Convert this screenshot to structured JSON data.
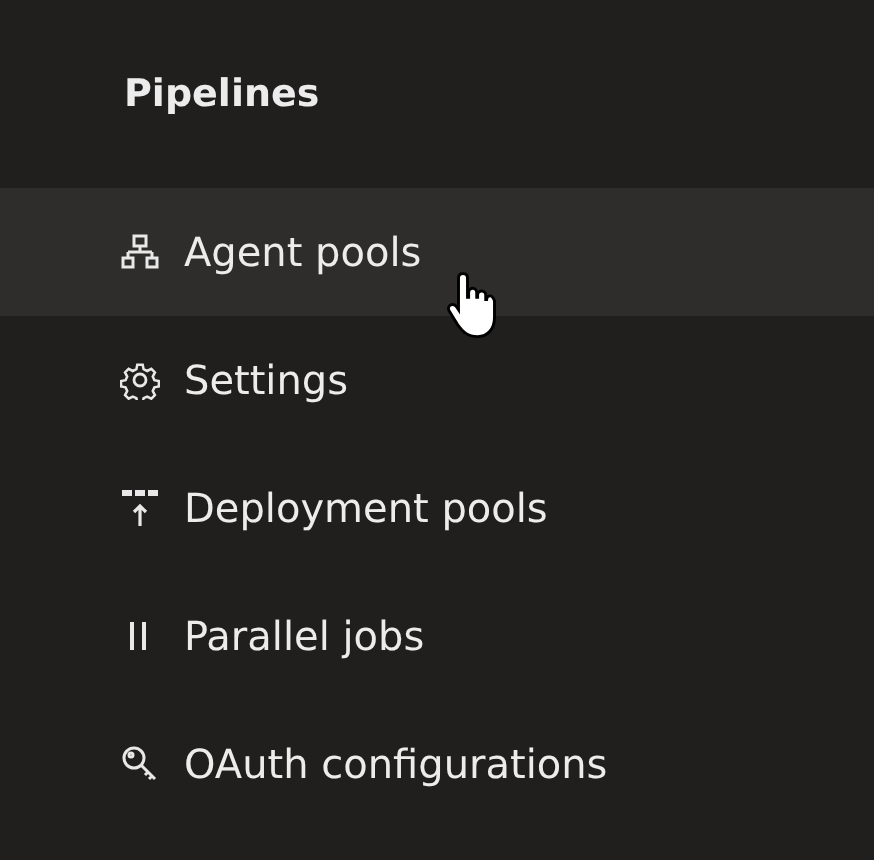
{
  "section": {
    "title": "Pipelines"
  },
  "items": [
    {
      "label": "Agent pools",
      "kind": "hierarchy",
      "hovered": true
    },
    {
      "label": "Settings",
      "kind": "gear",
      "hovered": false
    },
    {
      "label": "Deployment pools",
      "kind": "deploy",
      "hovered": false
    },
    {
      "label": "Parallel jobs",
      "kind": "parallel",
      "hovered": false
    },
    {
      "label": "OAuth configurations",
      "kind": "key",
      "hovered": false
    }
  ]
}
